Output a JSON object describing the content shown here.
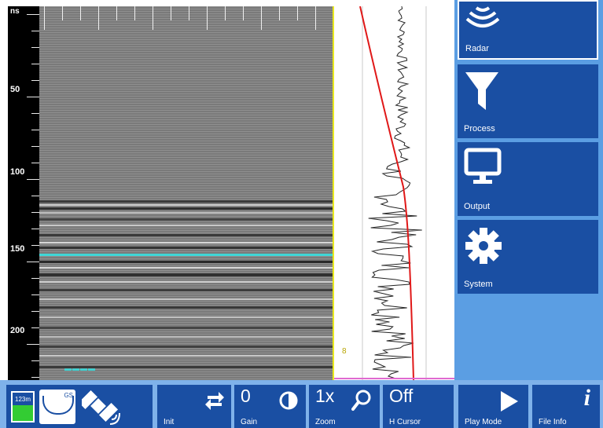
{
  "depth_scale": {
    "unit": "ns",
    "labels": [
      {
        "text": "50",
        "value": 50
      },
      {
        "text": "100",
        "value": 100
      },
      {
        "text": "150",
        "value": 150
      },
      {
        "text": "200",
        "value": 200
      }
    ]
  },
  "side_menu": {
    "items": [
      {
        "label": "Radar",
        "icon": "radar-icon",
        "active": true
      },
      {
        "label": "Process",
        "icon": "funnel-icon",
        "active": false
      },
      {
        "label": "Output",
        "icon": "monitor-icon",
        "active": false
      },
      {
        "label": "System",
        "icon": "gear-icon",
        "active": false
      }
    ]
  },
  "status": {
    "battery_text": "123m",
    "gps_text": "GS"
  },
  "controls": {
    "init_label": "Init",
    "gain_value": "0",
    "gain_label": "Gain",
    "zoom_value": "1x",
    "zoom_label": "Zoom",
    "hcursor_value": "Off",
    "hcursor_label": "H Cursor",
    "playmode_label": "Play Mode",
    "fileinfo_label": "File Info"
  },
  "trace": {
    "marker_text": "8"
  },
  "colors": {
    "accent_blue": "#1a4fa3",
    "panel_blue": "#5b9ee3",
    "cursor_cyan": "#3fd6d6",
    "gain_curve_red": "#e01818",
    "trace_border_yellow": "#e8e81e"
  }
}
